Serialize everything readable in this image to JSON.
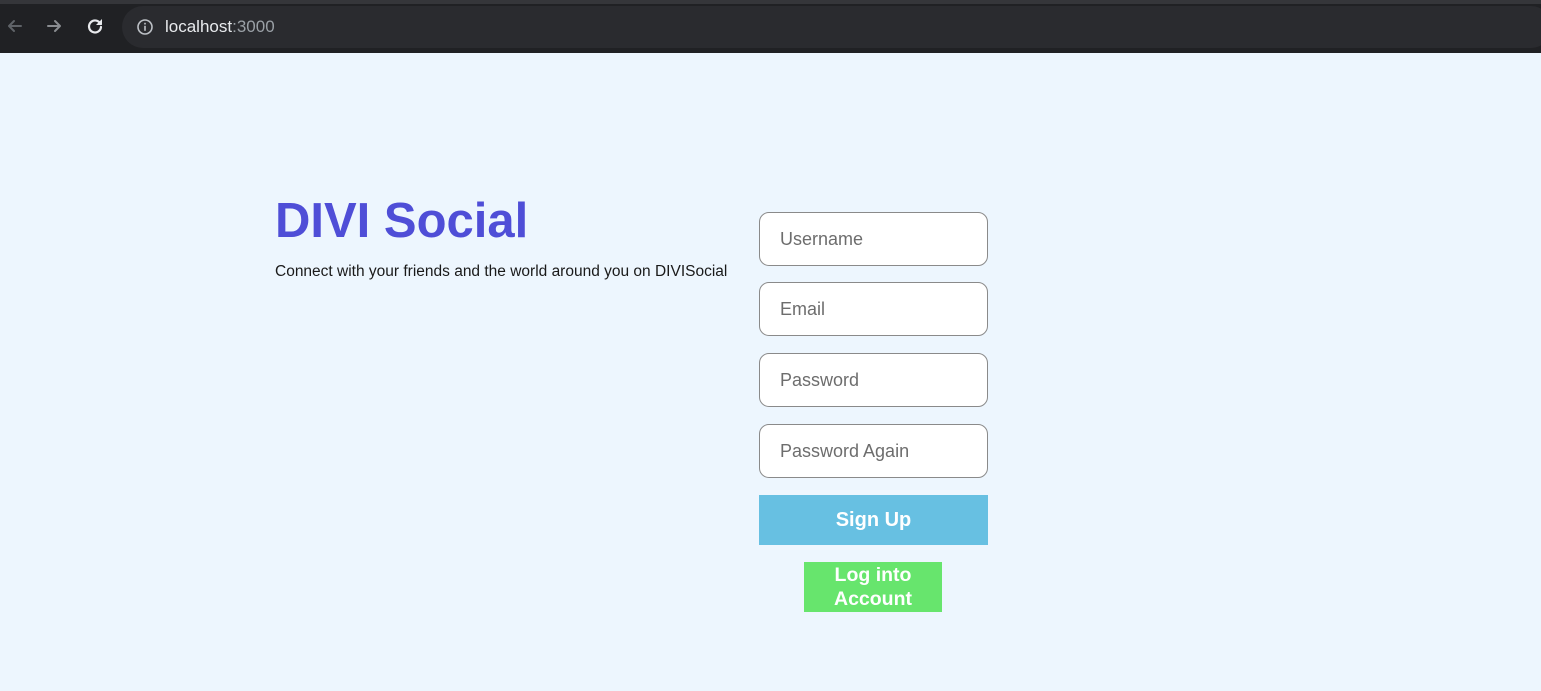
{
  "browser": {
    "url_host": "localhost",
    "url_port": ":3000",
    "icons": {
      "back": "arrow-left-icon",
      "forward": "arrow-right-icon",
      "reload": "reload-icon",
      "info": "info-icon"
    }
  },
  "brand": {
    "title": "DIVI Social",
    "description": "Connect with your friends and the world around you on DIVISocial",
    "title_color": "#4f4ed7"
  },
  "form": {
    "username_placeholder": "Username",
    "email_placeholder": "Email",
    "password_placeholder": "Password",
    "password_again_placeholder": "Password Again",
    "signup_label": "Sign Up",
    "login_label": "Log into Account",
    "signup_color": "#67c0e2",
    "login_color": "#67e56d"
  }
}
